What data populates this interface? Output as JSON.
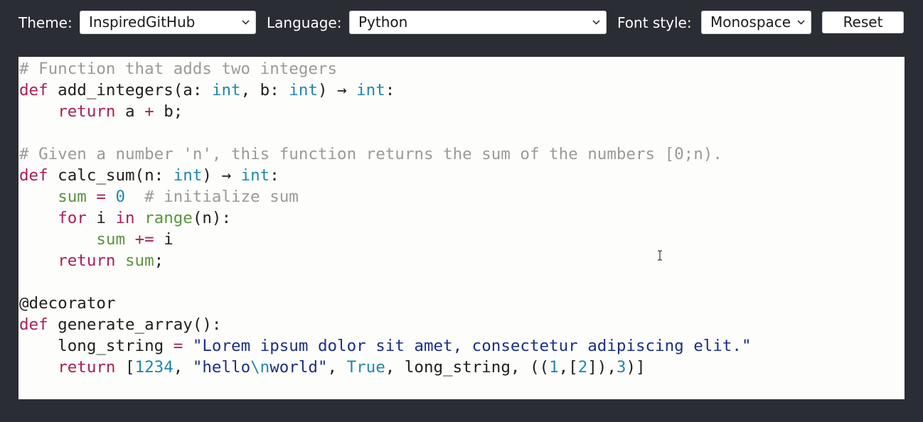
{
  "toolbar": {
    "theme_label": "Theme:",
    "theme_value": "InspiredGitHub",
    "language_label": "Language:",
    "language_value": "Python",
    "font_label": "Font style:",
    "font_value": "Monospace",
    "reset_label": "Reset"
  },
  "icons": {
    "dropdown": "chevron-down-icon",
    "cursor": "text-cursor-icon"
  },
  "colors": {
    "background": "#2a2d33",
    "editor_background": "#fdfdfb",
    "comment": "#9a9a9a",
    "keyword": "#a8205a",
    "type": "#1e88ad",
    "string": "#1b2f86",
    "builtin": "#5a9440"
  },
  "code": {
    "lines": [
      [
        {
          "t": "# Function that adds two integers",
          "c": "comment"
        }
      ],
      [
        {
          "t": "def",
          "c": "keyword"
        },
        {
          "t": " add_integers(a: ",
          "c": "text"
        },
        {
          "t": "int",
          "c": "type"
        },
        {
          "t": ", b: ",
          "c": "text"
        },
        {
          "t": "int",
          "c": "type"
        },
        {
          "t": ") → ",
          "c": "text"
        },
        {
          "t": "int",
          "c": "type"
        },
        {
          "t": ":",
          "c": "text"
        }
      ],
      [
        {
          "t": "    ",
          "c": "text"
        },
        {
          "t": "return",
          "c": "keyword"
        },
        {
          "t": " a ",
          "c": "text"
        },
        {
          "t": "+",
          "c": "keyword"
        },
        {
          "t": " b;",
          "c": "text"
        }
      ],
      [],
      [
        {
          "t": "# Given a number 'n', this function returns the sum of the numbers [0;n).",
          "c": "comment"
        }
      ],
      [
        {
          "t": "def",
          "c": "keyword"
        },
        {
          "t": " calc_sum(n: ",
          "c": "text"
        },
        {
          "t": "int",
          "c": "type"
        },
        {
          "t": ") → ",
          "c": "text"
        },
        {
          "t": "int",
          "c": "type"
        },
        {
          "t": ":",
          "c": "text"
        }
      ],
      [
        {
          "t": "    ",
          "c": "text"
        },
        {
          "t": "sum",
          "c": "var"
        },
        {
          "t": " ",
          "c": "text"
        },
        {
          "t": "=",
          "c": "keyword"
        },
        {
          "t": " ",
          "c": "text"
        },
        {
          "t": "0",
          "c": "number"
        },
        {
          "t": "  ",
          "c": "text"
        },
        {
          "t": "# initialize sum",
          "c": "comment"
        }
      ],
      [
        {
          "t": "    ",
          "c": "text"
        },
        {
          "t": "for",
          "c": "keyword"
        },
        {
          "t": " i ",
          "c": "text"
        },
        {
          "t": "in",
          "c": "keyword"
        },
        {
          "t": " ",
          "c": "text"
        },
        {
          "t": "range",
          "c": "builtin"
        },
        {
          "t": "(n):",
          "c": "text"
        }
      ],
      [
        {
          "t": "        ",
          "c": "text"
        },
        {
          "t": "sum",
          "c": "var"
        },
        {
          "t": " ",
          "c": "text"
        },
        {
          "t": "+=",
          "c": "keyword"
        },
        {
          "t": " i",
          "c": "text"
        }
      ],
      [
        {
          "t": "    ",
          "c": "text"
        },
        {
          "t": "return",
          "c": "keyword"
        },
        {
          "t": " ",
          "c": "text"
        },
        {
          "t": "sum",
          "c": "var"
        },
        {
          "t": ";",
          "c": "text"
        }
      ],
      [],
      [
        {
          "t": "@decorator",
          "c": "text"
        }
      ],
      [
        {
          "t": "def",
          "c": "keyword"
        },
        {
          "t": " generate_array():",
          "c": "text"
        }
      ],
      [
        {
          "t": "    long_string ",
          "c": "text"
        },
        {
          "t": "=",
          "c": "keyword"
        },
        {
          "t": " ",
          "c": "text"
        },
        {
          "t": "\"Lorem ipsum dolor sit amet, consectetur adipiscing elit.\"",
          "c": "string"
        }
      ],
      [
        {
          "t": "    ",
          "c": "text"
        },
        {
          "t": "return",
          "c": "keyword"
        },
        {
          "t": " [",
          "c": "text"
        },
        {
          "t": "1234",
          "c": "number"
        },
        {
          "t": ", ",
          "c": "text"
        },
        {
          "t": "\"hello",
          "c": "string"
        },
        {
          "t": "\\n",
          "c": "escape"
        },
        {
          "t": "world\"",
          "c": "string"
        },
        {
          "t": ", ",
          "c": "text"
        },
        {
          "t": "True",
          "c": "type"
        },
        {
          "t": ", long_string, ((",
          "c": "text"
        },
        {
          "t": "1",
          "c": "number"
        },
        {
          "t": ",[",
          "c": "text"
        },
        {
          "t": "2",
          "c": "number"
        },
        {
          "t": "]),",
          "c": "text"
        },
        {
          "t": "3",
          "c": "number"
        },
        {
          "t": ")]",
          "c": "text"
        }
      ]
    ]
  }
}
